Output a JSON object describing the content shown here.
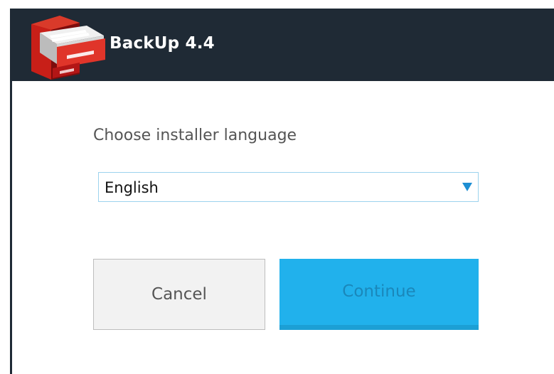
{
  "window": {
    "title": "BackUp 4.4",
    "icon": "filing-cabinet-icon"
  },
  "installer": {
    "prompt": "Choose installer language",
    "language_select": {
      "selected": "English",
      "dropdown_icon": "dropdown-triangle-icon"
    },
    "buttons": {
      "cancel_label": "Cancel",
      "continue_label": "Continue"
    }
  },
  "colors": {
    "title_bar": "#1f2a35",
    "continue_button": "#21b1ec",
    "continue_text": "#1a87ba",
    "cancel_button": "#f2f2f2",
    "select_border": "#9cd3ee",
    "dropdown_arrow": "#1e8fd3"
  }
}
